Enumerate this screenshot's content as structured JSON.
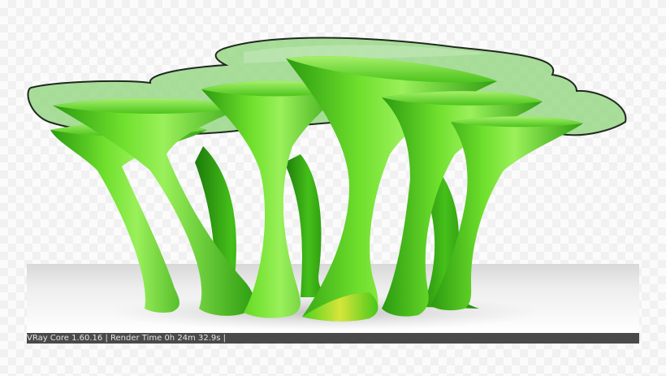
{
  "scene": {
    "subject": "green-tree-table-render",
    "colors": {
      "glass": "#8fcf7a",
      "glass_edge": "#1f2a1f",
      "plastic_light": "#7de03a",
      "plastic_mid": "#44c41a",
      "plastic_dark": "#1f8a0c",
      "floor": "#e6e6e6",
      "status_bar": "#4a4a4a"
    }
  },
  "status_bar": {
    "text": "VRay Core 1.60.16 | Render Time 0h 24m 32.9s |"
  }
}
